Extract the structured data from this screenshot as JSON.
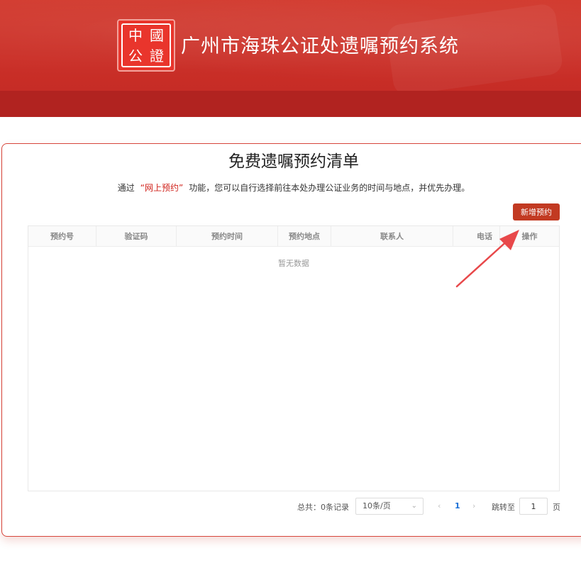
{
  "header": {
    "title": "广州市海珠公证处遗嘱预约系统",
    "logo_chars": [
      "中",
      "國",
      "公",
      "證"
    ]
  },
  "card": {
    "title": "免费遗嘱预约清单",
    "desc_prefix": "通过",
    "desc_highlight": "“网上预约”",
    "desc_suffix": "功能，您可以自行选择前往本处办理公证业务的时间与地点，并优先办理。",
    "add_button": "新增预约"
  },
  "table": {
    "columns": [
      "预约号",
      "验证码",
      "预约时间",
      "预约地点",
      "联系人",
      "电话",
      "操作"
    ],
    "empty_text": "暂无数据"
  },
  "pagination": {
    "total": "总共：0条记录",
    "page_size": "10条/页",
    "prev_icon": "‹",
    "current_page": "1",
    "next_icon": "›",
    "jump_label": "跳转至",
    "jump_value": "1",
    "page_unit": "页"
  },
  "colors": {
    "brand_red": "#c92e27",
    "button": "#c23a22",
    "highlight": "#d0231c",
    "link_blue": "#1a6fd6",
    "arrow": "#e8484a"
  }
}
